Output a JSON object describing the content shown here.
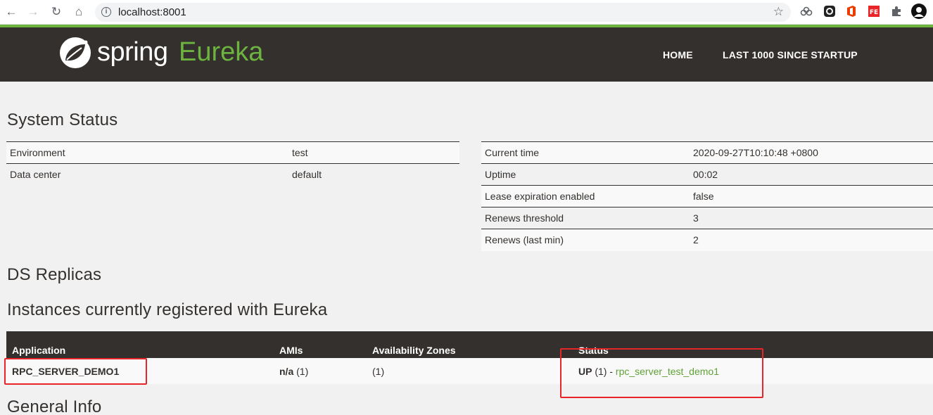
{
  "browser": {
    "url": "localhost:8001",
    "icons": [
      "back-icon",
      "forward-icon",
      "reload-icon",
      "home-icon",
      "info-icon",
      "star-icon",
      "extension-icons",
      "puzzle-icon",
      "avatar"
    ]
  },
  "navbar": {
    "logo_spring": "spring",
    "logo_eureka": "Eureka",
    "links": [
      "HOME",
      "LAST 1000 SINCE STARTUP"
    ]
  },
  "system_status": {
    "title": "System Status",
    "left": [
      {
        "key": "Environment",
        "value": "test"
      },
      {
        "key": "Data center",
        "value": "default"
      }
    ],
    "right": [
      {
        "key": "Current time",
        "value": "2020-09-27T10:10:48 +0800"
      },
      {
        "key": "Uptime",
        "value": "00:02"
      },
      {
        "key": "Lease expiration enabled",
        "value": "false"
      },
      {
        "key": "Renews threshold",
        "value": "3"
      },
      {
        "key": "Renews (last min)",
        "value": "2"
      }
    ]
  },
  "ds_replicas": {
    "title": "DS Replicas"
  },
  "instances": {
    "title": "Instances currently registered with Eureka",
    "columns": [
      "Application",
      "AMIs",
      "Availability Zones",
      "Status"
    ],
    "rows": [
      {
        "application": "RPC_SERVER_DEMO1",
        "amis_label": "n/a",
        "amis_count": "(1)",
        "zones": "(1)",
        "status_label": "UP",
        "status_count": "(1) -",
        "instance_link": "rpc_server_test_demo1"
      }
    ]
  },
  "general_info": {
    "title": "General Info"
  },
  "colors": {
    "brand_green": "#6db33f",
    "navbar": "#34302d",
    "highlight": "#e8262a"
  }
}
